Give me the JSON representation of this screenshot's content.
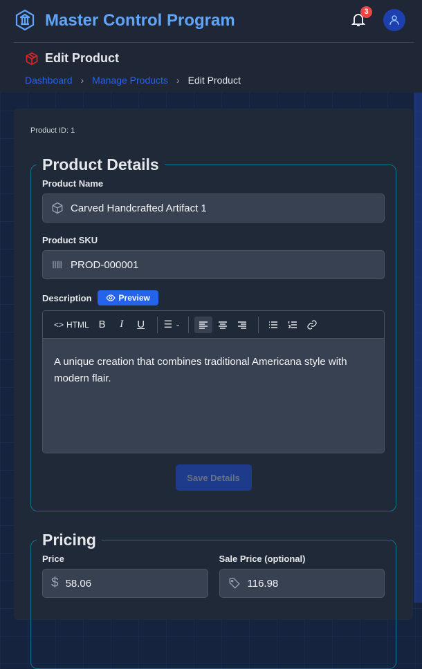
{
  "header": {
    "title": "Master Control Program",
    "notification_count": "3"
  },
  "page": {
    "title": "Edit Product",
    "breadcrumb": [
      "Dashboard",
      "Manage Products",
      "Edit Product"
    ]
  },
  "product_id": "Product ID: 1",
  "details": {
    "legend": "Product Details",
    "name_label": "Product Name",
    "name_value": "Carved Handcrafted Artifact 1",
    "sku_label": "Product SKU",
    "sku_value": "PROD-000001",
    "desc_label": "Description",
    "preview_label": "Preview",
    "html_label": "HTML",
    "description": "A unique creation that combines traditional Americana style with modern flair.",
    "save_label": "Save Details"
  },
  "pricing": {
    "legend": "Pricing",
    "price_label": "Price",
    "price_value": "58.06",
    "sale_label": "Sale Price (optional)",
    "sale_value": "116.98"
  }
}
